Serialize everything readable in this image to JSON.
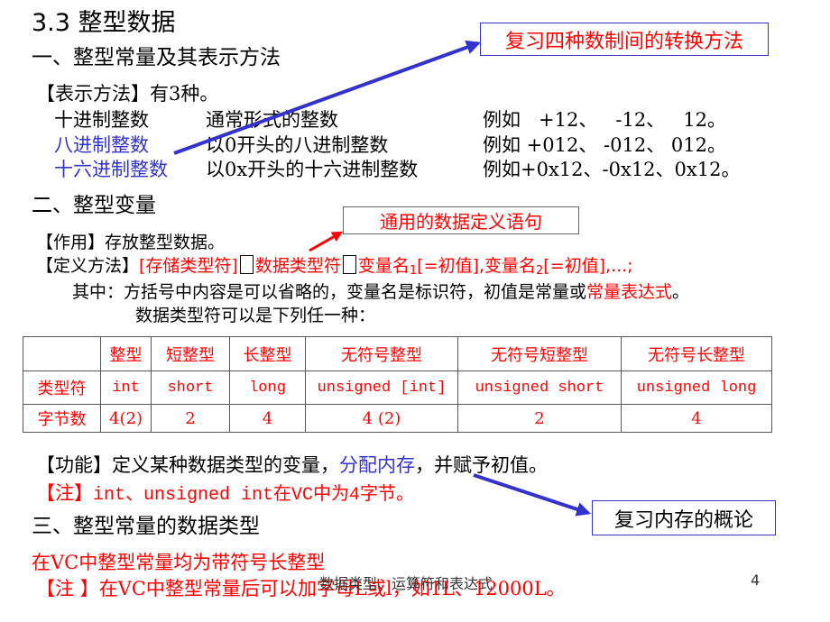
{
  "section_title": "3.3   整型数据",
  "part1": {
    "heading": "一、整型常量及其表示方法",
    "intro": "【表示方法】有3种。",
    "rows": [
      {
        "name": "十进制整数",
        "desc": "通常形式的整数",
        "example": "例如   +12、   -12、   12。"
      },
      {
        "name": "八进制整数",
        "desc": "以0开头的八进制整数",
        "example": "例如 +012、 -012、 012。"
      },
      {
        "name": "十六进制整数",
        "desc": "以0x开头的十六进制整数",
        "example": "例如+0x12、-0x12、0x12。"
      }
    ],
    "callout": "复习四种数制间的转换方法"
  },
  "part2": {
    "heading": "二、整型变量",
    "purpose_label": "【作用】",
    "purpose_text": "存放整型数据。",
    "def_label": "【定义方法】",
    "def_storage": "[存储类型符]",
    "def_datatype": "数据类型符",
    "def_var1": "变量名",
    "def_sub1": "1",
    "def_init1": "[=初值],",
    "def_var2": "变量名",
    "def_sub2": "2",
    "def_init2": "[=初值],...;",
    "callout": "通用的数据定义语句",
    "note_prefix": "其中：方括号中内容是可以省略的，变量名是标识符，初值是常量或",
    "note_highlight": "常量表达式",
    "note_suffix": "。",
    "list_intro": "数据类型符可以是下列任一种：",
    "table": {
      "headers": [
        "",
        "整型",
        "短整型",
        "长整型",
        "无符号整型",
        "无符号短整型",
        "无符号长整型"
      ],
      "rows": [
        [
          "类型符",
          "int",
          "short",
          "long",
          "unsigned [int]",
          "unsigned short",
          "unsigned long"
        ],
        [
          "字节数",
          "4(2)",
          "2",
          "4",
          "4 (2)",
          "2",
          "4"
        ]
      ]
    },
    "function_label": "【功能】",
    "function_text": "定义某种数据类型的变量，",
    "function_highlight": "分配内存",
    "function_suffix": "，并赋予初值。",
    "note_label": "【注】",
    "note_text": "int、unsigned int在VC中为4字节。",
    "memory_callout": "复习内存的概论"
  },
  "part3": {
    "heading": "三、整型常量的数据类型",
    "line1": "在VC中整型常量均为带符号长整型",
    "note_label": "【注 】",
    "note_text": "在VC中整型常量后可以加字母L或l，如1L、12000L。"
  },
  "footer": {
    "title": "数据类型、运算符和表达式",
    "page_number": "4"
  },
  "colors": {
    "accent_red": "#ff0000",
    "accent_blue": "#3333cc"
  }
}
